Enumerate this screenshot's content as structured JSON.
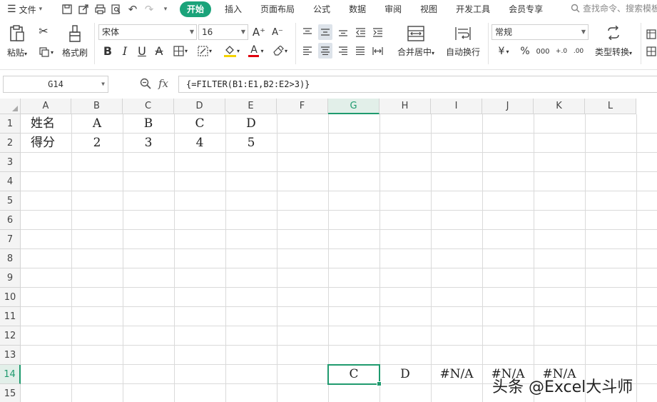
{
  "menubar": {
    "file_label": "文件",
    "tabs": [
      "开始",
      "插入",
      "页面布局",
      "公式",
      "数据",
      "审阅",
      "视图",
      "开发工具",
      "会员专享"
    ],
    "search_placeholder": "查找命令、搜索模板"
  },
  "ribbon": {
    "paste_label": "粘贴",
    "format_painter_label": "格式刷",
    "font_name": "宋体",
    "font_size": "16",
    "merge_center_label": "合并居中",
    "wrap_text_label": "自动换行",
    "number_format": "常规",
    "convert_type_label": "类型转换",
    "currency_symbol": "¥",
    "percent_symbol": "%",
    "thousands_symbol": "000",
    "increase_decimal": "+.0",
    "decrease_decimal": ".00",
    "bold": "B",
    "italic": "I",
    "underline": "U",
    "strike": "A",
    "font_color_letter": "A",
    "grow_font": "A⁺",
    "shrink_font": "A⁻",
    "accent_color": "#1aa37a"
  },
  "formula_bar": {
    "name_box": "G14",
    "fx_label": "fx",
    "formula": "{=FILTER(B1:E1,B2:E2>3)}"
  },
  "grid": {
    "columns": [
      "A",
      "B",
      "C",
      "D",
      "E",
      "F",
      "G",
      "H",
      "I",
      "J",
      "K",
      "L"
    ],
    "selected_column": "G",
    "rows": [
      "1",
      "2",
      "3",
      "4",
      "5",
      "6",
      "7",
      "8",
      "9",
      "10",
      "11",
      "12",
      "13",
      "14",
      "15"
    ],
    "selected_row": "14",
    "cells": {
      "A1": "姓名",
      "B1": "A",
      "C1": "B",
      "D1": "C",
      "E1": "D",
      "A2": "得分",
      "B2": "2",
      "C2": "3",
      "D2": "4",
      "E2": "5",
      "G14": "C",
      "H14": "D",
      "I14": "#N/A",
      "J14": "#N/A",
      "K14": "#N/A"
    }
  },
  "watermark": "头条 @Excel大斗师"
}
